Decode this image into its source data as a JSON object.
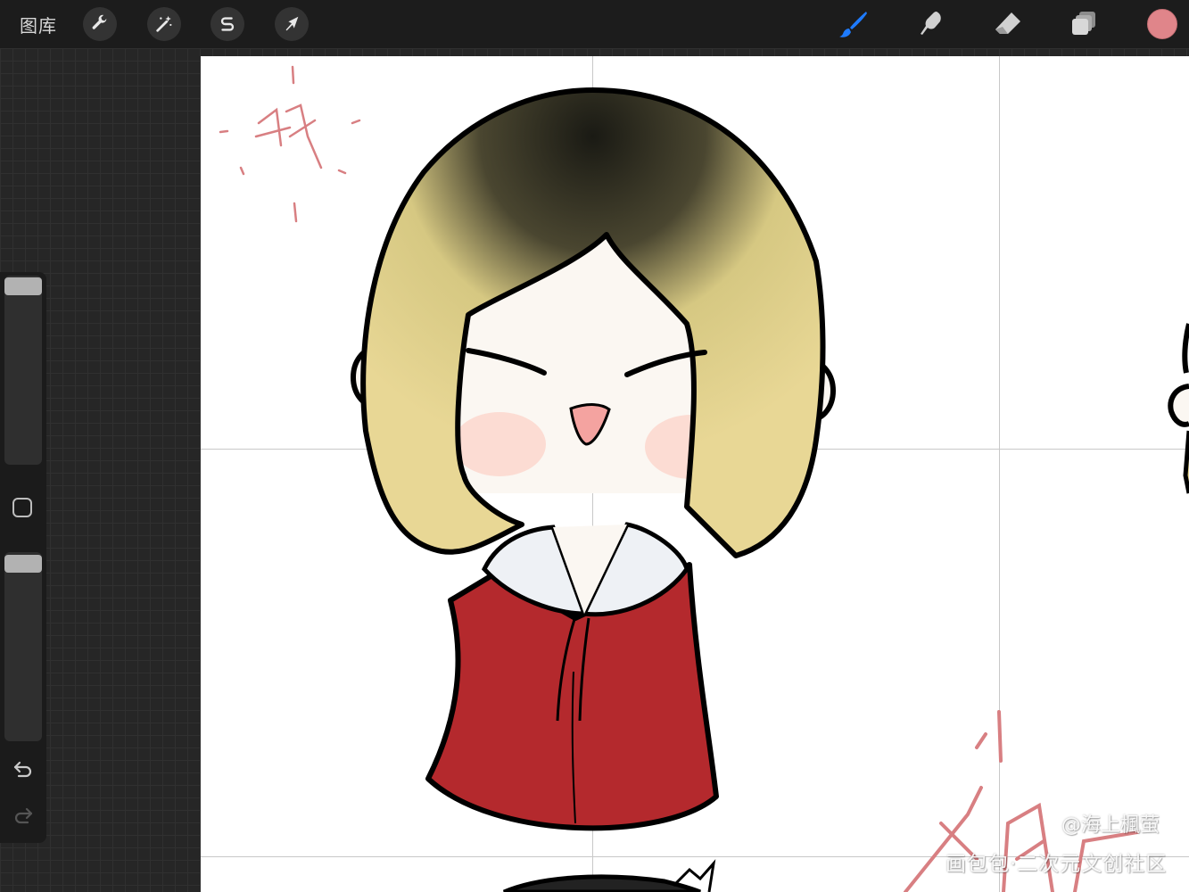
{
  "toolbar": {
    "gallery_label": "图库",
    "actions_icon": "wrench-icon",
    "adjustments_icon": "magic-wand-icon",
    "selection_icon": "selection-s-icon",
    "transform_icon": "arrow-cursor-icon",
    "brush_icon": "brush-icon",
    "smudge_icon": "smudge-icon",
    "eraser_icon": "eraser-icon",
    "layers_icon": "layers-icon",
    "active_color": "#e0858a",
    "brush_active_color": "#1e7bff"
  },
  "sidebar": {
    "size_slider_value": 1.0,
    "opacity_slider_value": 1.0,
    "modify_icon": "square-icon",
    "undo_icon": "undo-icon",
    "redo_icon": "redo-icon"
  },
  "canvas": {
    "background": "#ffffff",
    "artwork": "chibi-character-drawing",
    "signature_char": "枫"
  },
  "watermark": {
    "author": "@海上楓萤",
    "site": "画包包·二次元文创社区"
  }
}
